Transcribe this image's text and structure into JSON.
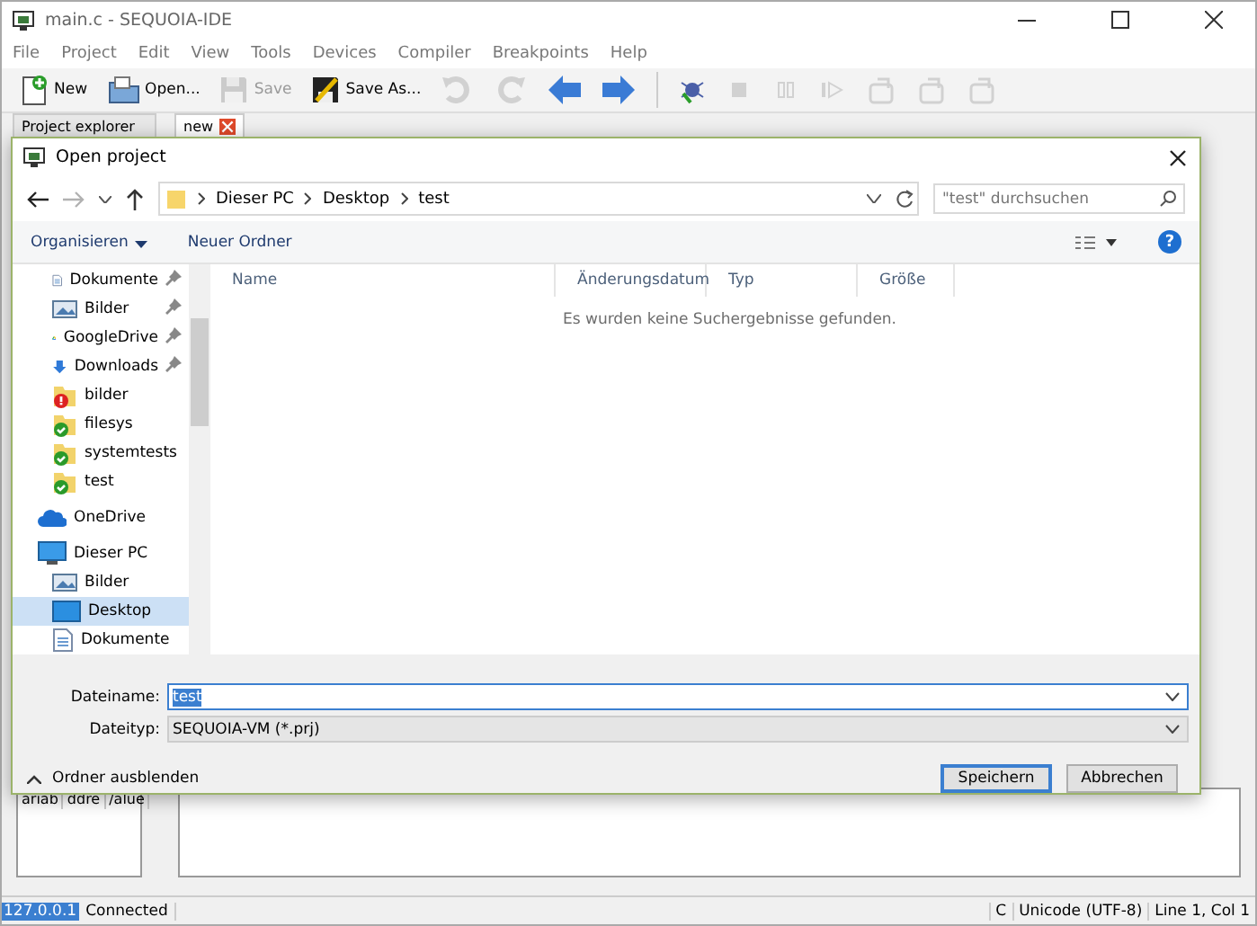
{
  "window": {
    "title": "main.c - SEQUOIA-IDE"
  },
  "menu": [
    "File",
    "Project",
    "Edit",
    "View",
    "Tools",
    "Devices",
    "Compiler",
    "Breakpoints",
    "Help"
  ],
  "toolbar": [
    {
      "kind": "new",
      "label": "New",
      "disabled": false
    },
    {
      "kind": "open",
      "label": "Open...",
      "disabled": false
    },
    {
      "kind": "save",
      "label": "Save",
      "disabled": true
    },
    {
      "kind": "saveas",
      "label": "Save As...",
      "disabled": false
    },
    {
      "kind": "undo",
      "disabled": true
    },
    {
      "kind": "redo",
      "disabled": true
    },
    {
      "kind": "back",
      "disabled": false
    },
    {
      "kind": "forward",
      "disabled": false
    },
    {
      "kind": "sep"
    },
    {
      "kind": "debug",
      "disabled": false
    },
    {
      "kind": "stop",
      "disabled": true
    },
    {
      "kind": "pause",
      "disabled": true
    },
    {
      "kind": "step",
      "disabled": true
    },
    {
      "kind": "stepover",
      "disabled": true
    },
    {
      "kind": "stepinto",
      "disabled": true
    },
    {
      "kind": "stepout",
      "disabled": true
    }
  ],
  "panel_tabs": [
    {
      "label": "Project explorer"
    }
  ],
  "editor_tabs": [
    {
      "label": "new",
      "selected": true
    }
  ],
  "dialog": {
    "title": "Open project",
    "nav_buttons": [
      {
        "kind": "back",
        "disabled": false
      },
      {
        "kind": "forward",
        "disabled": true
      }
    ],
    "breadcrumb": [
      "Dieser PC",
      "Desktop",
      "test"
    ],
    "search": {
      "placeholder": "\"test\" durchsuchen"
    },
    "commands": [
      {
        "label": "Organisieren",
        "dropdown": true
      },
      {
        "label": "Neuer Ordner",
        "dropdown": false
      }
    ],
    "help_button": "?",
    "quick_access": [
      {
        "label": "Dokumente",
        "kind": "document",
        "pinned": true
      },
      {
        "label": "Bilder",
        "kind": "pictures",
        "pinned": true
      },
      {
        "label": "GoogleDrive",
        "kind": "drive",
        "pinned": true
      },
      {
        "label": "Downloads",
        "kind": "download",
        "pinned": true
      },
      {
        "label": "bilder",
        "kind": "folder-error",
        "pinned": false
      },
      {
        "label": "filesys",
        "kind": "folder-ok",
        "pinned": false
      },
      {
        "label": "systemtests",
        "kind": "folder-ok",
        "pinned": false
      },
      {
        "label": "test",
        "kind": "folder-ok",
        "pinned": false
      }
    ],
    "places": [
      {
        "label": "OneDrive",
        "kind": "cloud",
        "selected": false
      },
      {
        "label": "Dieser PC",
        "kind": "computer",
        "selected": false,
        "children": [
          {
            "label": "Bilder",
            "kind": "pictures",
            "selected": false
          },
          {
            "label": "Desktop",
            "kind": "desktop",
            "selected": true
          },
          {
            "label": "Dokumente",
            "kind": "document",
            "selected": false
          }
        ]
      }
    ],
    "columns": [
      "Name",
      "Änderungsdatum",
      "Typ",
      "Größe"
    ],
    "empty_message": "Es wurden keine Suchergebnisse gefunden.",
    "filename": {
      "label": "Dateiname:",
      "value": "test"
    },
    "filetype": {
      "label": "Dateityp:",
      "value": "SEQUOIA-VM (*.prj)"
    },
    "toggle_folders": "Ordner ausblenden",
    "buttons": [
      {
        "label": "Speichern",
        "default": true
      },
      {
        "label": "Abbrechen",
        "default": false
      }
    ]
  },
  "watch_columns": [
    "ariab",
    "ddre",
    "/alue"
  ],
  "status_bar": {
    "address": "127.0.0.1",
    "connection": "Connected",
    "fields": [
      "C",
      "Unicode (UTF-8)",
      "Line 1, Col 1"
    ]
  }
}
